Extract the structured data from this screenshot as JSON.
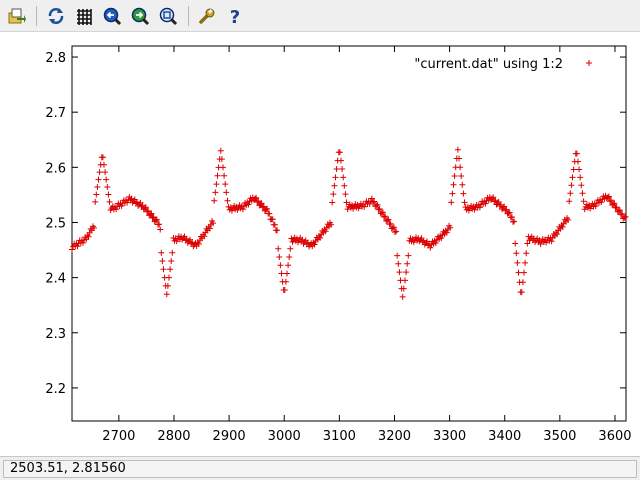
{
  "toolbar": {
    "buttons": [
      {
        "name": "export-button",
        "icon": "export-icon"
      },
      {
        "name": "replot-button",
        "icon": "replot-icon"
      },
      {
        "name": "grid-button",
        "icon": "grid-icon"
      },
      {
        "name": "zoom-previous-button",
        "icon": "zoom-previous-icon"
      },
      {
        "name": "zoom-next-button",
        "icon": "zoom-next-icon"
      },
      {
        "name": "autoscale-button",
        "icon": "autoscale-icon"
      },
      {
        "name": "settings-button",
        "icon": "wrench-icon"
      },
      {
        "name": "help-button",
        "icon": "help-icon"
      }
    ]
  },
  "status": {
    "coordinates": "2503.51,  2.81560"
  },
  "colors": {
    "series": "#dd0000",
    "toolbar_bg": "#efefef"
  },
  "chart_data": {
    "type": "scatter",
    "marker": "+",
    "legend_position": "top-right",
    "grid": false,
    "xlim": [
      2615,
      3620
    ],
    "ylim": [
      2.14,
      2.82
    ],
    "xticks": [
      2700,
      2800,
      2900,
      3000,
      3100,
      3200,
      3300,
      3400,
      3500,
      3600
    ],
    "yticks": [
      2.2,
      2.3,
      2.4,
      2.5,
      2.6,
      2.7,
      2.8
    ],
    "series": [
      {
        "name": "\"current.dat\" using 1:2",
        "color": "#dd0000",
        "x_start": 2615,
        "x_end": 3620,
        "x_step": 2,
        "baseline_keypoints": [
          [
            2615,
            2.455
          ],
          [
            2640,
            2.47
          ],
          [
            2665,
            2.51
          ],
          [
            2675,
            2.53
          ],
          [
            2690,
            2.525
          ],
          [
            2720,
            2.543
          ],
          [
            2745,
            2.528
          ],
          [
            2770,
            2.5
          ],
          [
            2790,
            2.465
          ],
          [
            2815,
            2.473
          ],
          [
            2840,
            2.458
          ],
          [
            2870,
            2.5
          ],
          [
            2900,
            2.525
          ],
          [
            2925,
            2.528
          ],
          [
            2945,
            2.545
          ],
          [
            2970,
            2.52
          ],
          [
            2995,
            2.47
          ],
          [
            3030,
            2.468
          ],
          [
            3050,
            2.458
          ],
          [
            3085,
            2.5
          ],
          [
            3110,
            2.528
          ],
          [
            3140,
            2.53
          ],
          [
            3160,
            2.54
          ],
          [
            3190,
            2.5
          ],
          [
            3215,
            2.465
          ],
          [
            3245,
            2.47
          ],
          [
            3265,
            2.458
          ],
          [
            3290,
            2.48
          ],
          [
            3330,
            2.525
          ],
          [
            3350,
            2.528
          ],
          [
            3375,
            2.545
          ],
          [
            3405,
            2.52
          ],
          [
            3435,
            2.475
          ],
          [
            3465,
            2.465
          ],
          [
            3485,
            2.47
          ],
          [
            3520,
            2.515
          ],
          [
            3545,
            2.528
          ],
          [
            3560,
            2.53
          ],
          [
            3585,
            2.548
          ],
          [
            3620,
            2.505
          ]
        ],
        "spikes_up": [
          {
            "x": 2670,
            "peak": 2.625
          },
          {
            "x": 2885,
            "peak": 2.63
          },
          {
            "x": 3100,
            "peak": 2.635
          },
          {
            "x": 3315,
            "peak": 2.632
          },
          {
            "x": 3530,
            "peak": 2.632
          }
        ],
        "spikes_down": [
          {
            "x": 2787,
            "trough": 2.37
          },
          {
            "x": 3000,
            "trough": 2.37
          },
          {
            "x": 3215,
            "trough": 2.365
          },
          {
            "x": 3430,
            "trough": 2.365
          }
        ]
      }
    ]
  }
}
